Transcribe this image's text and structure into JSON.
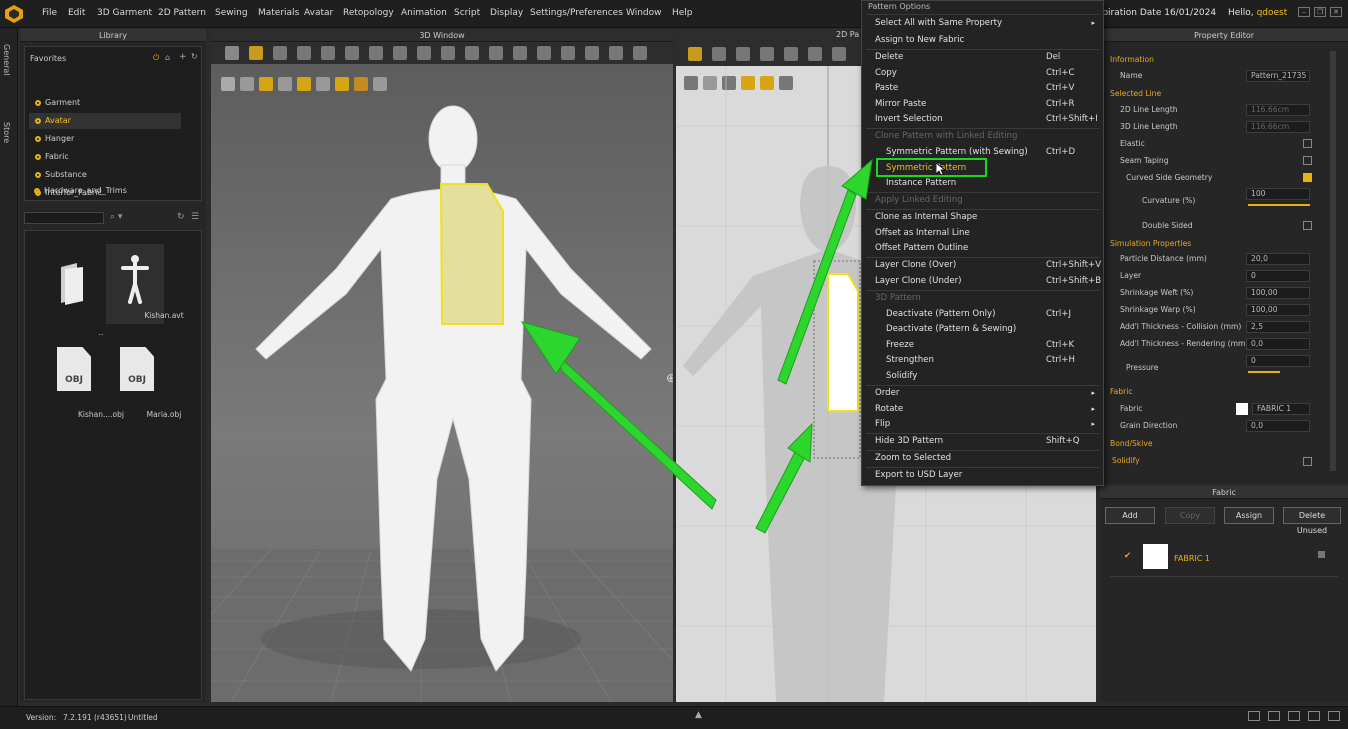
{
  "menubar": {
    "items": [
      "File",
      "Edit",
      "3D Garment",
      "2D Pattern",
      "Sewing",
      "Materials",
      "Avatar",
      "Retopology",
      "Animation",
      "Script",
      "Display",
      "Settings/Preferences",
      "Window",
      "Help"
    ],
    "expiry": "xpiration Date 16/01/2024",
    "hello": "Hello,",
    "user": "qdoest"
  },
  "sidetabs": [
    "General",
    "Store"
  ],
  "library": {
    "title": "Library",
    "favorites_label": "Favorites",
    "favorites": [
      "Garment",
      "Avatar",
      "Hanger",
      "Fabric",
      "Substance",
      "Interior_Fabric",
      "Hardware_and_Trims"
    ],
    "files": [
      {
        "name": "..",
        "icon": "folder-icon"
      },
      {
        "name": "Kishan.avt",
        "icon": "avatar-icon"
      },
      {
        "name": "Kishan....obj",
        "icon": "obj-file-icon",
        "tag": "OBJ"
      },
      {
        "name": "Maria.obj",
        "icon": "obj-file-icon",
        "tag": "OBJ"
      }
    ]
  },
  "window3d": {
    "title": "3D Window"
  },
  "window2d": {
    "title": "2D Pa"
  },
  "context_menu": {
    "title": "Pattern Options",
    "items": [
      {
        "label": "Select All with Same Property",
        "shortcut": "",
        "arrow": "▸"
      },
      {
        "label": "Assign to New Fabric",
        "shortcut": ""
      },
      {
        "label": "Delete",
        "shortcut": "Del"
      },
      {
        "label": "Copy",
        "shortcut": "Ctrl+C"
      },
      {
        "label": "Paste",
        "shortcut": "Ctrl+V"
      },
      {
        "label": "Mirror Paste",
        "shortcut": "Ctrl+R"
      },
      {
        "label": "Invert Selection",
        "shortcut": "Ctrl+Shift+I"
      },
      {
        "label": "Clone Pattern with Linked Editing",
        "shortcut": ""
      },
      {
        "label": "Symmetric Pattern (with Sewing)",
        "shortcut": "Ctrl+D"
      },
      {
        "label": "Symmetric Pattern",
        "shortcut": ""
      },
      {
        "label": "Instance Pattern",
        "shortcut": ""
      },
      {
        "label": "Apply Linked Editing",
        "shortcut": ""
      },
      {
        "label": "Clone as Internal Shape",
        "shortcut": ""
      },
      {
        "label": "Offset as Internal Line",
        "shortcut": ""
      },
      {
        "label": "Offset Pattern Outline",
        "shortcut": ""
      },
      {
        "label": "Layer Clone (Over)",
        "shortcut": "Ctrl+Shift+V"
      },
      {
        "label": "Layer Clone (Under)",
        "shortcut": "Ctrl+Shift+B"
      },
      {
        "label": "3D Pattern",
        "shortcut": ""
      },
      {
        "label": "Deactivate (Pattern Only)",
        "shortcut": "Ctrl+J"
      },
      {
        "label": "Deactivate (Pattern & Sewing)",
        "shortcut": ""
      },
      {
        "label": "Freeze",
        "shortcut": "Ctrl+K"
      },
      {
        "label": "Strengthen",
        "shortcut": "Ctrl+H"
      },
      {
        "label": "Solidify",
        "shortcut": ""
      },
      {
        "label": "Order",
        "shortcut": "",
        "arrow": "▸"
      },
      {
        "label": "Rotate",
        "shortcut": "",
        "arrow": "▸"
      },
      {
        "label": "Flip",
        "shortcut": "",
        "arrow": "▸"
      },
      {
        "label": "Hide 3D Pattern",
        "shortcut": "Shift+Q"
      },
      {
        "label": "Zoom to Selected",
        "shortcut": ""
      },
      {
        "label": "Export to USD Layer",
        "shortcut": ""
      }
    ]
  },
  "property_editor": {
    "title": "Property Editor",
    "information": "Information",
    "name_label": "Name",
    "name_value": "Pattern_21735",
    "selected_line": "Selected Line",
    "line2d_label": "2D Line Length",
    "line2d_value": "116.66cm",
    "line3d_label": "3D Line Length",
    "line3d_value": "116.66cm",
    "elastic": "Elastic",
    "seam_taping": "Seam Taping",
    "curved_side": "Curved Side Geometry",
    "curvature_label": "Curvature (%)",
    "curvature_value": "100",
    "double_sided": "Double Sided",
    "sim_props": "Simulation Properties",
    "particle_label": "Particle Distance (mm)",
    "particle_value": "20,0",
    "layer_label": "Layer",
    "layer_value": "0",
    "weft_label": "Shrinkage Weft (%)",
    "weft_value": "100,00",
    "warp_label": "Shrinkage Warp (%)",
    "warp_value": "100,00",
    "collision_label": "Add'l Thickness - Collision (mm)",
    "collision_value": "2,5",
    "rendering_label": "Add'l Thickness - Rendering (mm)",
    "rendering_value": "0,0",
    "pressure_label": "Pressure",
    "pressure_value": "0",
    "fabric_sect": "Fabric",
    "fabric_label": "Fabric",
    "fabric_value": "FABRIC 1",
    "grain_label": "Grain Direction",
    "grain_value": "0,0",
    "bond_skive": "Bond/Skive",
    "solidify": "Solidify"
  },
  "fabric_panel": {
    "title": "Fabric",
    "add": "Add",
    "copy": "Copy",
    "assign": "Assign",
    "delete_unused": "Delete Unused",
    "fabric_name": "FABRIC 1"
  },
  "status": {
    "version_label": "Version:",
    "version": "7.2.191 (r43651)",
    "file": "Untitled"
  },
  "colors": {
    "accent": "#e8b310",
    "highlight": "#1fd51f",
    "pattern_fill": "#e0dc9a"
  }
}
